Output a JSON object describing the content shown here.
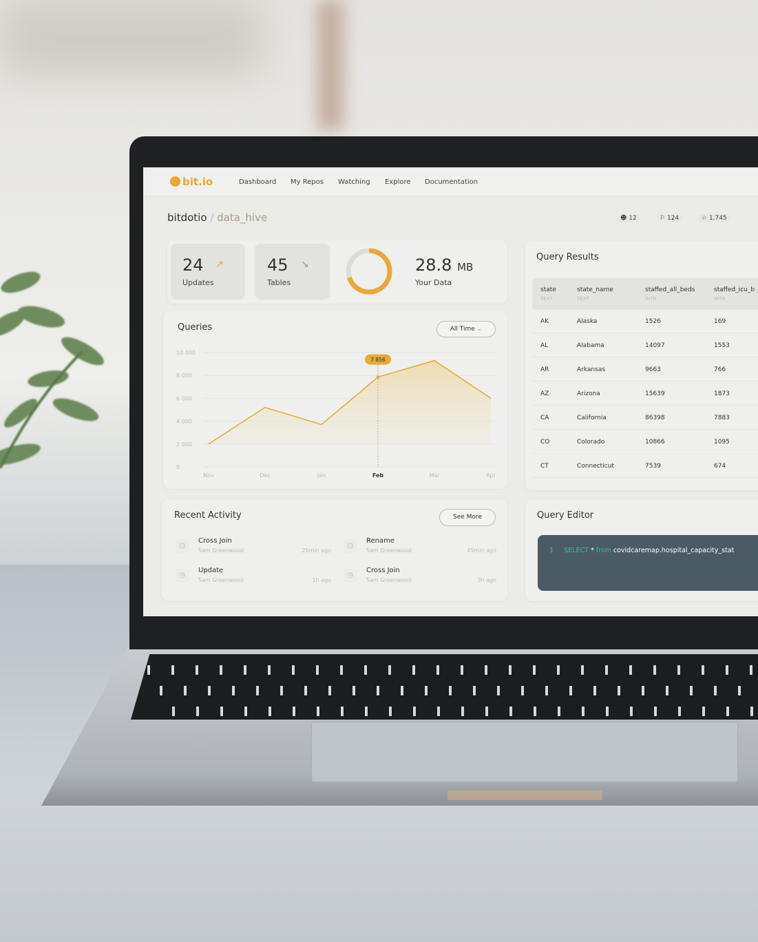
{
  "nav": {
    "logo": "bit.io",
    "links": [
      "Dashboard",
      "My Repos",
      "Watching",
      "Explore",
      "Documentation"
    ]
  },
  "breadcrumb": {
    "owner": "bitdotio",
    "separator": "/",
    "repo": "data_hive"
  },
  "repo_stats": [
    {
      "icon": "user-icon",
      "value": "12"
    },
    {
      "icon": "flag-icon",
      "value": "124"
    },
    {
      "icon": "star-icon",
      "value": "1,745"
    }
  ],
  "summary": {
    "updates": {
      "value": "24",
      "label": "Updates",
      "trend": "up"
    },
    "tables": {
      "value": "45",
      "label": "Tables",
      "trend": "down"
    },
    "data": {
      "value": "28.8",
      "unit": "MB",
      "label": "Your Data",
      "usage_fraction": 0.7
    }
  },
  "accent_color": "#e6a93a",
  "queries": {
    "title": "Queries",
    "range": "All Time",
    "tooltip": "7 856"
  },
  "chart_data": {
    "type": "area",
    "categories": [
      "Nov",
      "Dec",
      "Jan",
      "Feb",
      "Mar",
      "Apr"
    ],
    "values": [
      2000,
      5200,
      3700,
      7856,
      9300,
      6000
    ],
    "highlighted": "Feb",
    "yticks": [
      "0",
      "2 000",
      "4 000",
      "6 000",
      "8 000",
      "10 000"
    ],
    "ylim": [
      0,
      10000
    ],
    "grid": true
  },
  "activity": {
    "title": "Recent Activity",
    "see_more": "See More",
    "items": [
      {
        "action": "Cross Join",
        "user": "Sam Greenwood",
        "time": "25min ago"
      },
      {
        "action": "Rename",
        "user": "Sam Greenwood",
        "time": "45min ago"
      },
      {
        "action": "Update",
        "user": "Sam Greenwood",
        "time": "1h ago"
      },
      {
        "action": "Cross Join",
        "user": "Sam Greenwood",
        "time": "3h ago"
      }
    ]
  },
  "results": {
    "title": "Query Results",
    "columns": [
      {
        "name": "state",
        "type": "TEXT"
      },
      {
        "name": "state_name",
        "type": "TEXT"
      },
      {
        "name": "staffed_all_beds",
        "type": "INT8"
      },
      {
        "name": "staffed_icu_b",
        "type": "INT8"
      }
    ],
    "rows": [
      [
        "AK",
        "Alaska",
        "1526",
        "169"
      ],
      [
        "AL",
        "Alabama",
        "14097",
        "1553"
      ],
      [
        "AR",
        "Arkansas",
        "9663",
        "766"
      ],
      [
        "AZ",
        "Arizona",
        "15639",
        "1873"
      ],
      [
        "CA",
        "California",
        "86398",
        "7883"
      ],
      [
        "CO",
        "Colorado",
        "10866",
        "1095"
      ],
      [
        "CT",
        "Connecticut",
        "7539",
        "674"
      ]
    ]
  },
  "editor": {
    "title": "Query Editor",
    "line": "1",
    "kw1": "SELECT",
    "op": "*",
    "kw2": "from",
    "rest": "covidcaremap.hospital_capacity_stat"
  }
}
